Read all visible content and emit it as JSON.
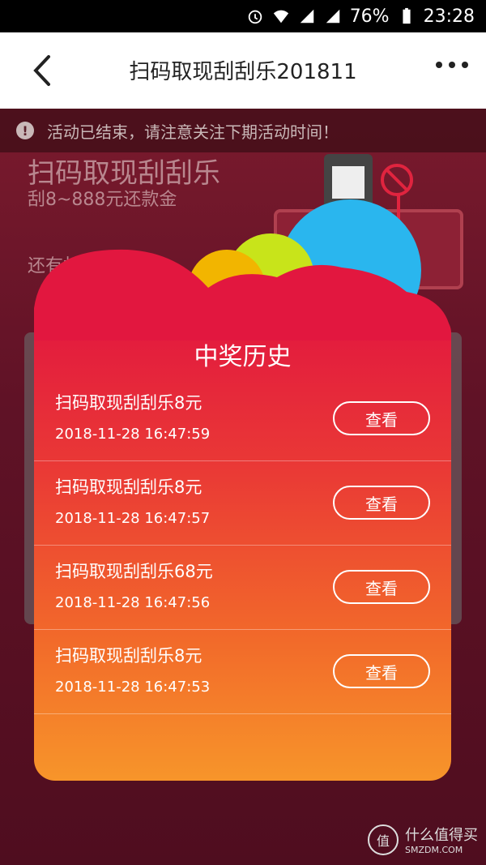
{
  "status_bar": {
    "battery": "76%",
    "time": "23:28"
  },
  "nav": {
    "title": "扫码取现刮刮乐201811"
  },
  "notice": {
    "icon": "!",
    "text": "活动已结束，请注意关注下期活动时间！"
  },
  "background": {
    "title": "扫码取现刮刮乐",
    "subtitle": "刮8~888元还款金",
    "hint": "还有机"
  },
  "modal": {
    "title": "中奖历史",
    "items": [
      {
        "name": "扫码取现刮刮乐8元",
        "time": "2018-11-28 16:47:59",
        "button": "查看"
      },
      {
        "name": "扫码取现刮刮乐8元",
        "time": "2018-11-28 16:47:57",
        "button": "查看"
      },
      {
        "name": "扫码取现刮刮乐68元",
        "time": "2018-11-28 16:47:56",
        "button": "查看"
      },
      {
        "name": "扫码取现刮刮乐8元",
        "time": "2018-11-28 16:47:53",
        "button": "查看"
      }
    ]
  },
  "watermark": {
    "logo": "值",
    "brand": "什么值得买",
    "domain": "SMZDM.COM"
  },
  "colors": {
    "modal_top": "#e2173f",
    "modal_bottom": "#f7952a",
    "backdrop": "#5a0f24"
  }
}
